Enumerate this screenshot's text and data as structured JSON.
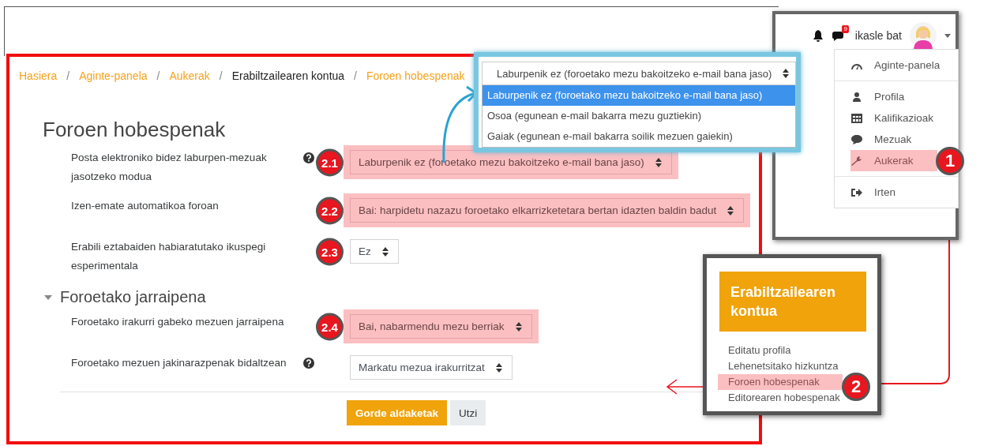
{
  "breadcrumb": [
    {
      "label": "Hasiera",
      "current": false
    },
    {
      "separator": "/",
      "label": "Aginte-panela",
      "current": false
    },
    {
      "separator": "/",
      "label": "Aukerak",
      "current": false
    },
    {
      "separator": "/",
      "label": "Erabiltzailearen kontua",
      "current": true
    },
    {
      "separator": "/",
      "label": "Foroen hobespenak",
      "current": false
    }
  ],
  "page_title": "Foroen hobespenak",
  "fields": [
    {
      "label": "Posta elektroniko bidez laburpen-mezuak jasotzeko modua",
      "help": true,
      "badge": "2.1",
      "highlighted": true,
      "value": "Laburpenik ez (foroetako mezu bakoitzeko e-mail bana jaso)"
    },
    {
      "label": "Izen-emate automatikoa foroan",
      "help": false,
      "badge": "2.2",
      "highlighted": true,
      "value": "Bai: harpidetu nazazu foroetako elkarrizketetara bertan idazten baldin badut"
    },
    {
      "label": "Erabili eztabaiden habiaratutako ikuspegi esperimentala",
      "help": false,
      "badge": "2.3",
      "highlighted": false,
      "value": "Ez"
    }
  ],
  "section": {
    "title": "Foroetako jarraipena",
    "expanded": true
  },
  "section_fields": [
    {
      "label": "Foroetako irakurri gabeko mezuen jarraipena",
      "help": false,
      "badge": "2.4",
      "highlighted": true,
      "value": "Bai, nabarmendu mezu berriak"
    },
    {
      "label": "Foroetako mezuen jakinarazpenak bidaltzean",
      "help": true,
      "highlighted": false,
      "value": "Markatu mezua irakurritzat"
    }
  ],
  "buttons": [
    {
      "label": "Gorde aldaketak",
      "kind": "primary"
    },
    {
      "label": "Utzi",
      "kind": "secondary"
    }
  ],
  "dropdown_callout": {
    "value": "Laburpenik ez (foroetako mezu bakoitzeko e-mail bana jaso)",
    "options": [
      {
        "label": "Laburpenik ez (foroetako mezu bakoitzeko e-mail bana jaso)",
        "selected": true
      },
      {
        "label": "Osoa (egunean e-mail bakarra mezu guztiekin)",
        "selected": false
      },
      {
        "label": "Gaiak (egunean e-mail bakarra soilik mezuen gaiekin)",
        "selected": false
      }
    ]
  },
  "user_menu": {
    "message_count": "9",
    "user_name": "ikasle bat",
    "badge": "1",
    "items": [
      {
        "label": "Aginte-panela",
        "kind": "dashboard",
        "highlighted": false,
        "divider_after": true
      },
      {
        "label": "Profila",
        "kind": "user",
        "highlighted": false,
        "divider_after": false
      },
      {
        "label": "Kalifikazioak",
        "kind": "table",
        "highlighted": false,
        "divider_after": false
      },
      {
        "label": "Mezuak",
        "kind": "comment",
        "highlighted": false,
        "divider_after": false
      },
      {
        "label": "Aukerak",
        "kind": "wrench",
        "highlighted": true,
        "divider_after": true
      },
      {
        "label": "Irten",
        "kind": "signout",
        "highlighted": false,
        "divider_after": false
      }
    ]
  },
  "account_block": {
    "title": "Erabiltzailearen kontua",
    "badge": "2",
    "links": [
      {
        "label": "Editatu profila",
        "highlighted": false
      },
      {
        "label": "Lehenetsitako hizkuntza",
        "highlighted": false
      },
      {
        "label": "Foroen hobespenak",
        "highlighted": true
      },
      {
        "label": "Editorearen hobespenak",
        "highlighted": false
      }
    ]
  }
}
